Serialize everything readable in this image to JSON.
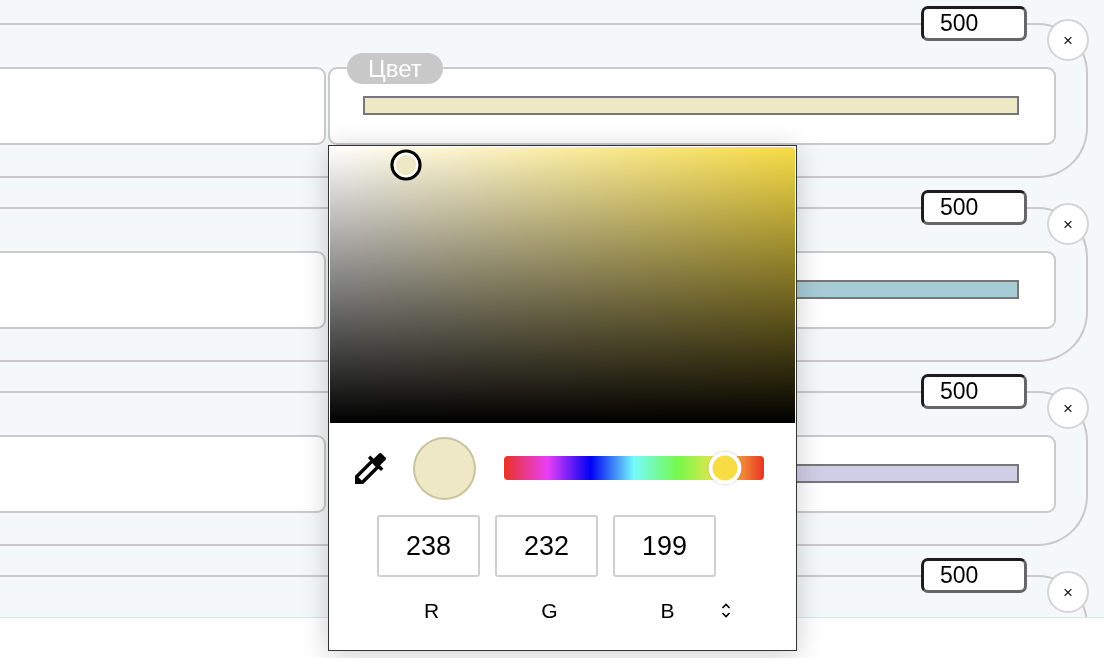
{
  "rows": [
    {
      "amount": "500",
      "remove": "×",
      "color_label": "Цвет",
      "color": "#eee8c7"
    },
    {
      "amount": "500",
      "remove": "×",
      "color": "#a6ccd6"
    },
    {
      "amount": "500",
      "remove": "×",
      "color": "#d0cde6"
    },
    {
      "amount": "500",
      "remove": "×"
    }
  ],
  "color_picker": {
    "hue_slider": {
      "level": 0.85
    },
    "channels": [
      {
        "value": "238",
        "label": "R"
      },
      {
        "value": "232",
        "label": "G"
      },
      {
        "value": "199",
        "label": "B"
      }
    ]
  }
}
